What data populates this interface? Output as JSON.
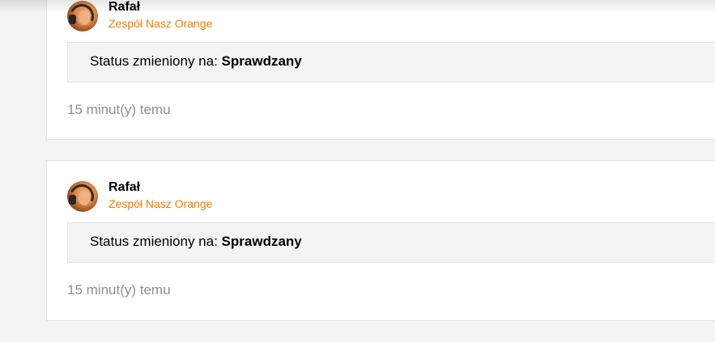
{
  "comments": [
    {
      "author": "Rafał",
      "team": "Zespół Nasz Orange",
      "status_prefix": "Status zmieniony na:",
      "status_value": "Sprawdzany",
      "time": "15 minut(y) temu"
    },
    {
      "author": "Rafał",
      "team": "Zespół Nasz Orange",
      "status_prefix": "Status zmieniony na:",
      "status_value": "Sprawdzany",
      "time": "15 minut(y) temu"
    }
  ],
  "colors": {
    "accent": "#ff7900",
    "page_background": "#f3f3f3",
    "card_background": "#ffffff",
    "status_box_background": "#f4f4f4",
    "timestamp": "#8f8f8f"
  },
  "icons": {
    "avatar": "user-avatar-photo"
  }
}
